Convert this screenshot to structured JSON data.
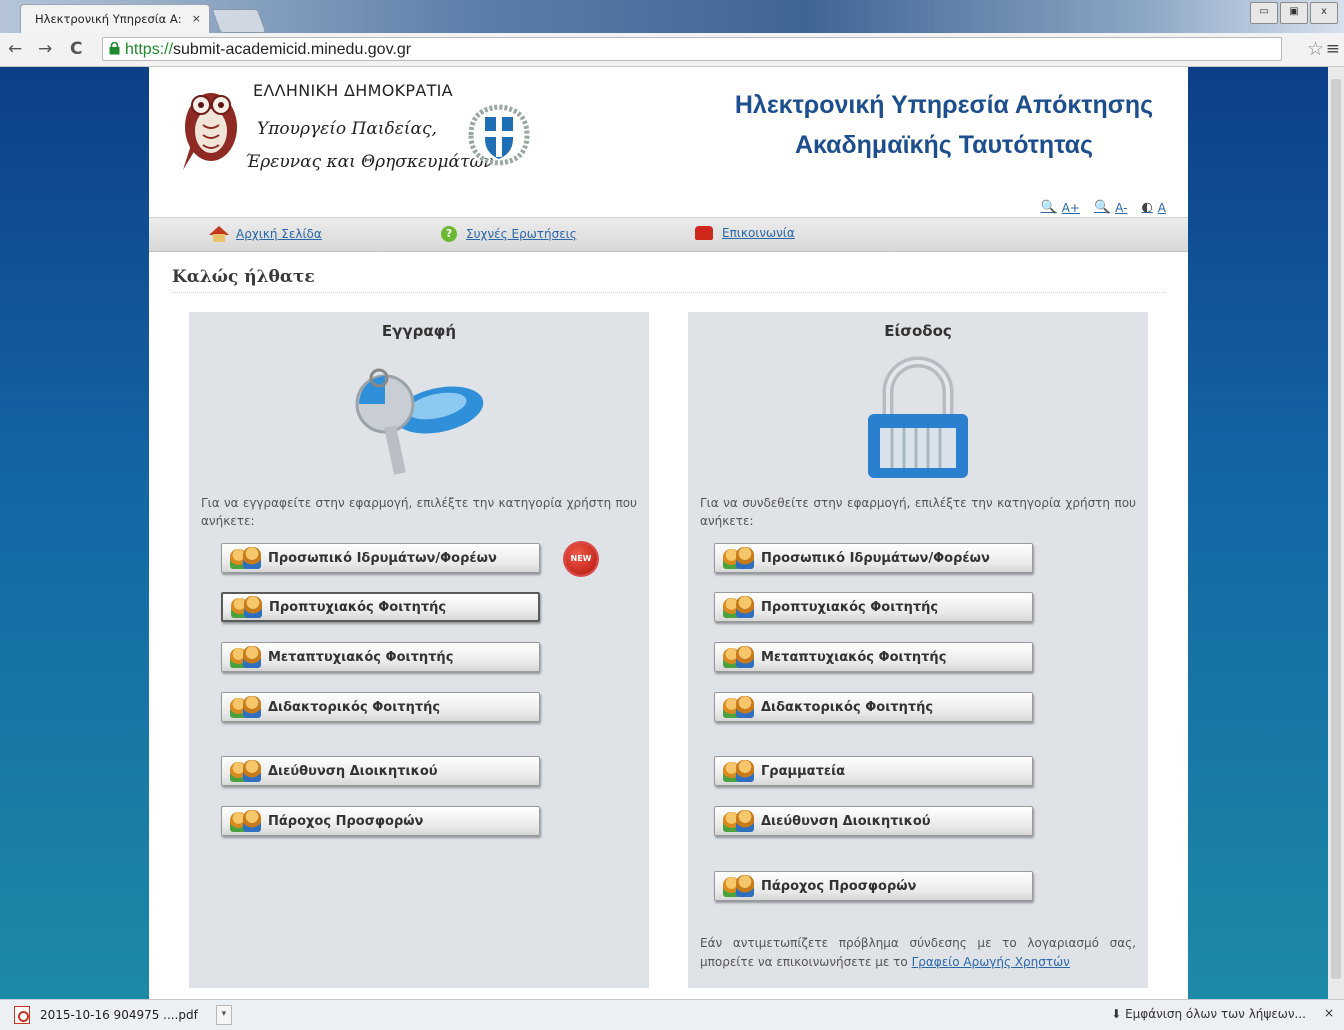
{
  "browser": {
    "tab_title": "Ηλεκτρονική Υπηρεσία Α:",
    "tab_close": "×",
    "url_scheme": "https://",
    "url_rest": "submit-academicid.minedu.gov.gr",
    "back": "←",
    "forward": "→",
    "reload": "C",
    "star": "☆",
    "menu": "≡",
    "win_min": "▭",
    "win_max": "▣",
    "win_close": "x"
  },
  "header": {
    "gov_line1": "ΕΛΛΗΝΙΚΗ ΔΗΜΟΚΡΑΤΙΑ",
    "gov_line2": "Υπουργείο Παιδείας,",
    "gov_line3": "Έρευνας και Θρησκευμάτων",
    "title_line1": "Ηλεκτρονική Υπηρεσία Απόκτησης",
    "title_line2": "Ακαδημαϊκής Ταυτότητας",
    "font_increase": "A+",
    "font_decrease": "A-",
    "contrast": "A"
  },
  "nav": {
    "home": "Αρχική Σελίδα",
    "faq": "Συχνές Ερωτήσεις",
    "contact": "Επικοινωνία"
  },
  "welcome": "Καλώς ήλθατε",
  "register": {
    "heading": "Εγγραφή",
    "intro": "Για να εγγραφείτε στην εφαρμογή, επιλέξτε την κατηγορία χρήστη που ανήκετε:",
    "new_badge": "NEW",
    "buttons": [
      "Προσωπικό Ιδρυμάτων/Φορέων",
      "Προπτυχιακός Φοιτητής",
      "Μεταπτυχιακός Φοιτητής",
      "Διδακτορικός Φοιτητής",
      "Διεύθυνση Διοικητικού",
      "Πάροχος Προσφορών"
    ]
  },
  "login": {
    "heading": "Είσοδος",
    "intro": "Για να συνδεθείτε στην εφαρμογή, επιλέξτε την κατηγορία χρήστη που ανήκετε:",
    "buttons": [
      "Προσωπικό Ιδρυμάτων/Φορέων",
      "Προπτυχιακός Φοιτητής",
      "Μεταπτυχιακός Φοιτητής",
      "Διδακτορικός Φοιτητής",
      "Γραμματεία",
      "Διεύθυνση Διοικητικού",
      "Πάροχος Προσφορών"
    ],
    "help_text": "Εάν αντιμετωπίζετε πρόβλημα σύνδεσης με το λογαριασμό σας, μπορείτε να επικοινωνήσετε με το ",
    "help_link": "Γραφείο Αρωγής Χρηστών"
  },
  "downloads": {
    "file": "2015-10-16 904975 ....pdf",
    "show_all": "Εμφάνιση όλων των λήψεων...",
    "close": "×"
  }
}
